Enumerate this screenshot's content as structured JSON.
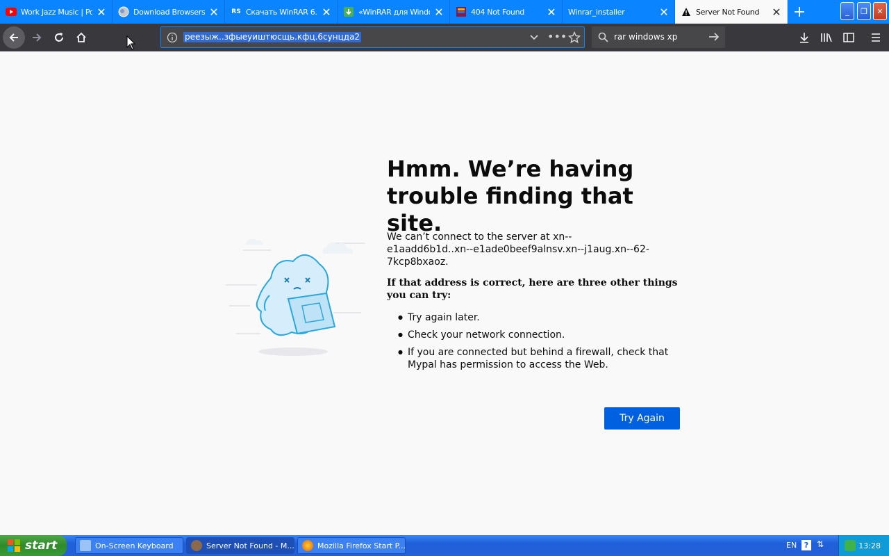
{
  "tabs": [
    {
      "title": "Work Jazz Music | Po",
      "favicon": "youtube-icon",
      "active": false
    },
    {
      "title": "Download Browsers -",
      "favicon": "globe-icon",
      "active": false
    },
    {
      "title": "Скачать WinRAR 6.",
      "favicon": "rs-icon",
      "active": false
    },
    {
      "title": "«WinRAR для Windo",
      "favicon": "download-icon",
      "active": false
    },
    {
      "title": "404 Not Found",
      "favicon": "winrar-icon",
      "active": false
    },
    {
      "title": "Winrar_installer",
      "favicon": "",
      "active": false
    },
    {
      "title": "Server Not Found",
      "favicon": "warning-icon",
      "active": true
    }
  ],
  "url": "реезыж..зфыеуиштюсщь.кфц.6сунцда2",
  "search_value": "rar windows xp",
  "page": {
    "title": "Hmm. We’re having trouble finding that site.",
    "description": "We can’t connect to the server at xn--e1aadd6b1d..xn--e1ade0beef9alnsv.xn--j1aug.xn--62-7kcp8bxaoz.",
    "subheading": "If that address is correct, here are three other things you can try:",
    "tips": [
      "Try again later.",
      "Check your network connection.",
      "If you are connected but behind a firewall, check that Mypal has permission to access the Web."
    ],
    "try_again_label": "Try Again"
  },
  "taskbar": {
    "start_label": "start",
    "items": [
      {
        "label": "On-Screen Keyboard",
        "active": false
      },
      {
        "label": "Server Not Found - M...",
        "active": true
      },
      {
        "label": "Mozilla Firefox Start P...",
        "active": false
      }
    ],
    "language": "EN",
    "clock": "13:28"
  },
  "colors": {
    "tabstrip": "#0a84ff",
    "navbar": "#38383d",
    "button": "#0060df",
    "taskbar": "#245edb"
  }
}
